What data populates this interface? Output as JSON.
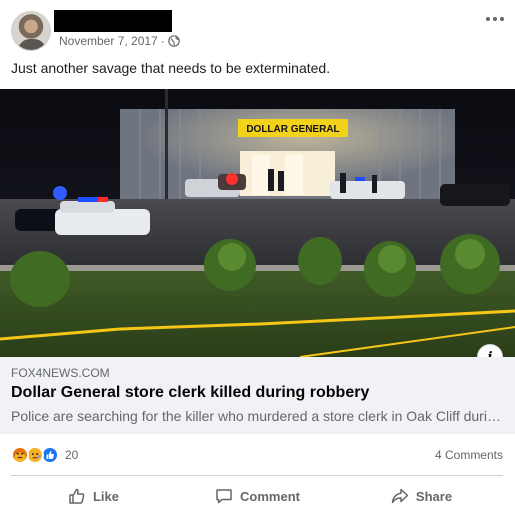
{
  "post": {
    "timestamp": "November 7, 2017",
    "separator": "·",
    "privacy_icon": "globe-icon",
    "text": "Just another savage that needs to be exterminated."
  },
  "link_preview": {
    "domain": "FOX4NEWS.COM",
    "title": "Dollar General store clerk killed during robbery",
    "description": "Police are searching for the killer who murdered a store clerk in Oak Cliff during a robbery.",
    "image_sign_text": "DOLLAR GENERAL"
  },
  "engagement": {
    "reaction_icons": [
      "angry-icon",
      "sad-icon",
      "like-icon"
    ],
    "reaction_count": "20",
    "comments": "4 Comments"
  },
  "actions": {
    "like_label": "Like",
    "comment_label": "Comment",
    "share_label": "Share"
  },
  "colors": {
    "meta_text": "#65676b",
    "link_box_bg": "#f0f2f5",
    "like_blue": "#1877f2",
    "sign_yellow": "#f3d21a"
  }
}
